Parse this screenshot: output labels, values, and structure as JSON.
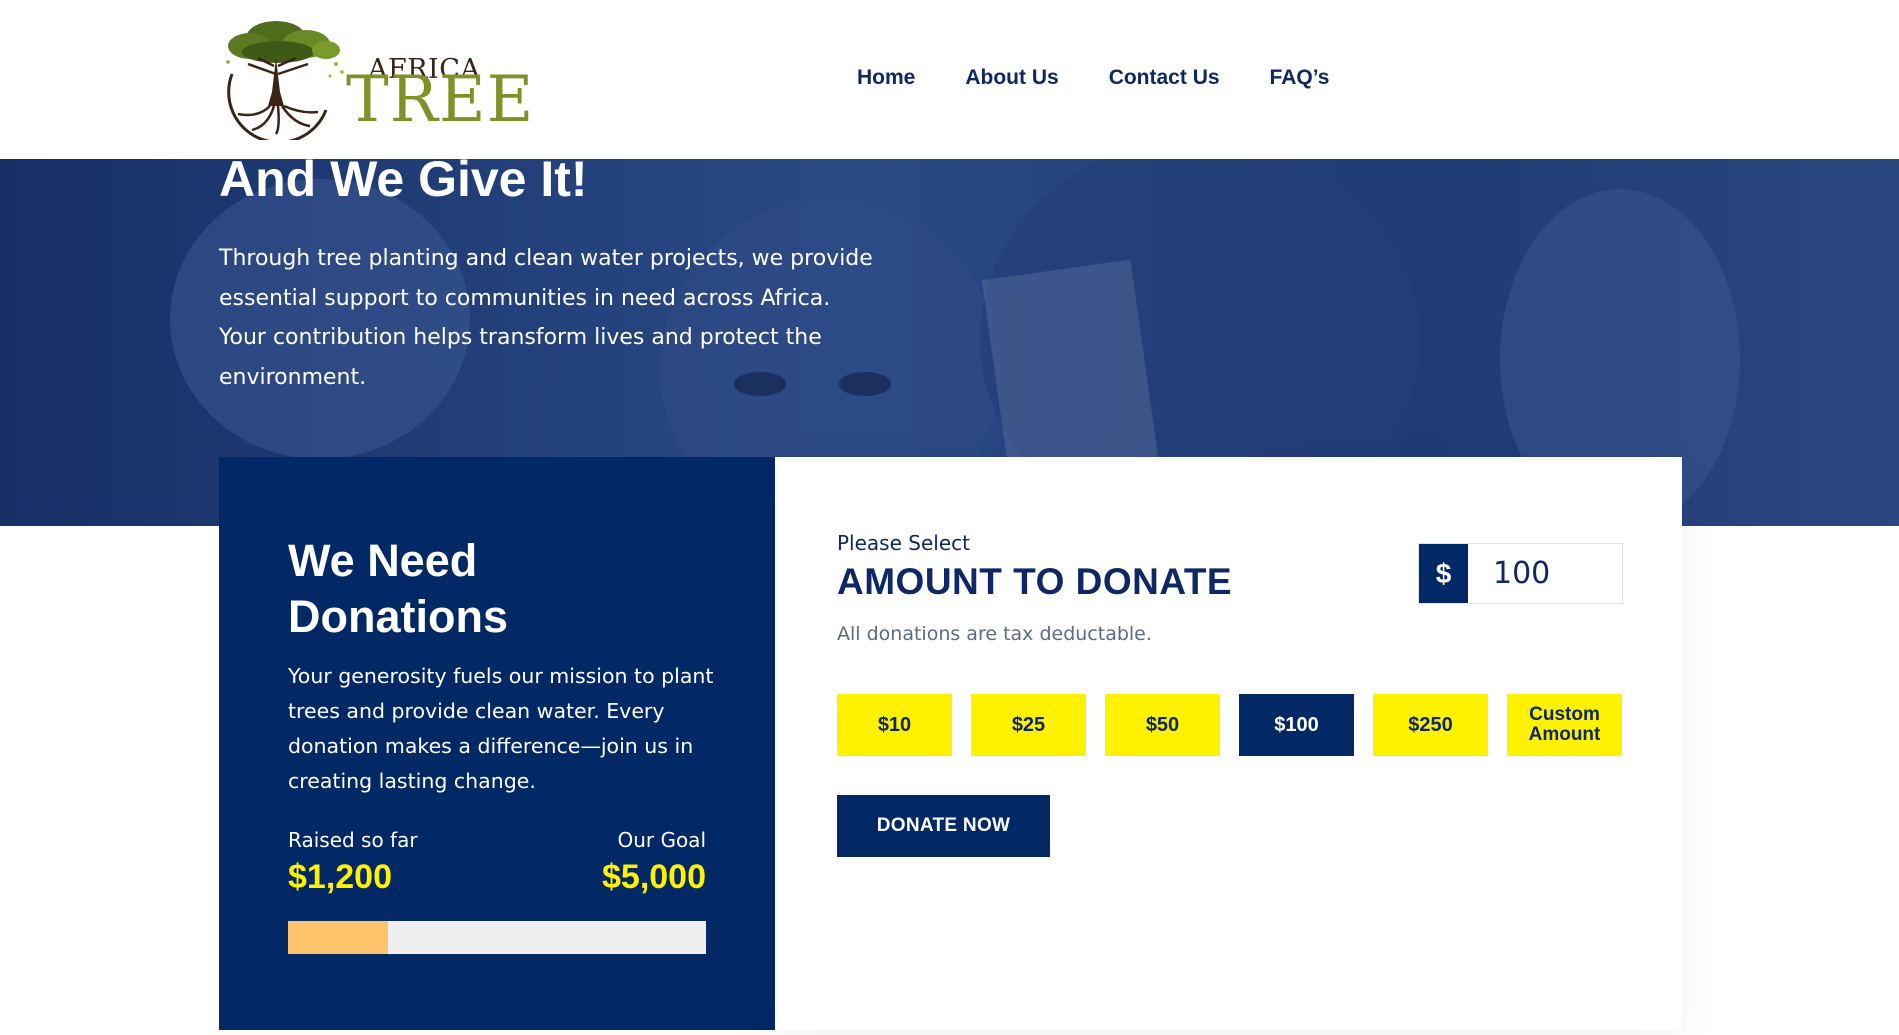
{
  "brand": {
    "logo_africa": "AFRICA",
    "logo_tree": "TREE",
    "colors": {
      "navy": "#022866",
      "yellow": "#fff200",
      "olive": "#7f9227",
      "progress": "#fdc46c"
    }
  },
  "nav": {
    "items": [
      {
        "label": "Home"
      },
      {
        "label": "About Us"
      },
      {
        "label": "Contact Us"
      },
      {
        "label": "FAQ’s"
      }
    ]
  },
  "hero": {
    "title": "And We Give It!",
    "text": "Through tree planting and clean water projects, we provide essential support to communities in need across Africa. Your contribution helps transform lives and protect the environment."
  },
  "donation_info": {
    "title": "We Need Donations",
    "text": "Your generosity fuels our mission to plant trees and provide clean water. Every donation makes a difference—join us in creating lasting change.",
    "raised_label": "Raised so far",
    "raised_value": "$1,200",
    "goal_label": "Our Goal",
    "goal_value": "$5,000",
    "progress_fraction": 0.24
  },
  "donate_form": {
    "please_select": "Please Select",
    "title": "AMOUNT TO DONATE",
    "tax_note": "All donations are tax deductable.",
    "currency_symbol": "$",
    "amount_value": "100",
    "amount_options": [
      {
        "label": "$10",
        "selected": false
      },
      {
        "label": "$25",
        "selected": false
      },
      {
        "label": "$50",
        "selected": false
      },
      {
        "label": "$100",
        "selected": true
      },
      {
        "label": "$250",
        "selected": false
      },
      {
        "label": "Custom\nAmount",
        "selected": false
      }
    ],
    "donate_button": "DONATE NOW"
  }
}
